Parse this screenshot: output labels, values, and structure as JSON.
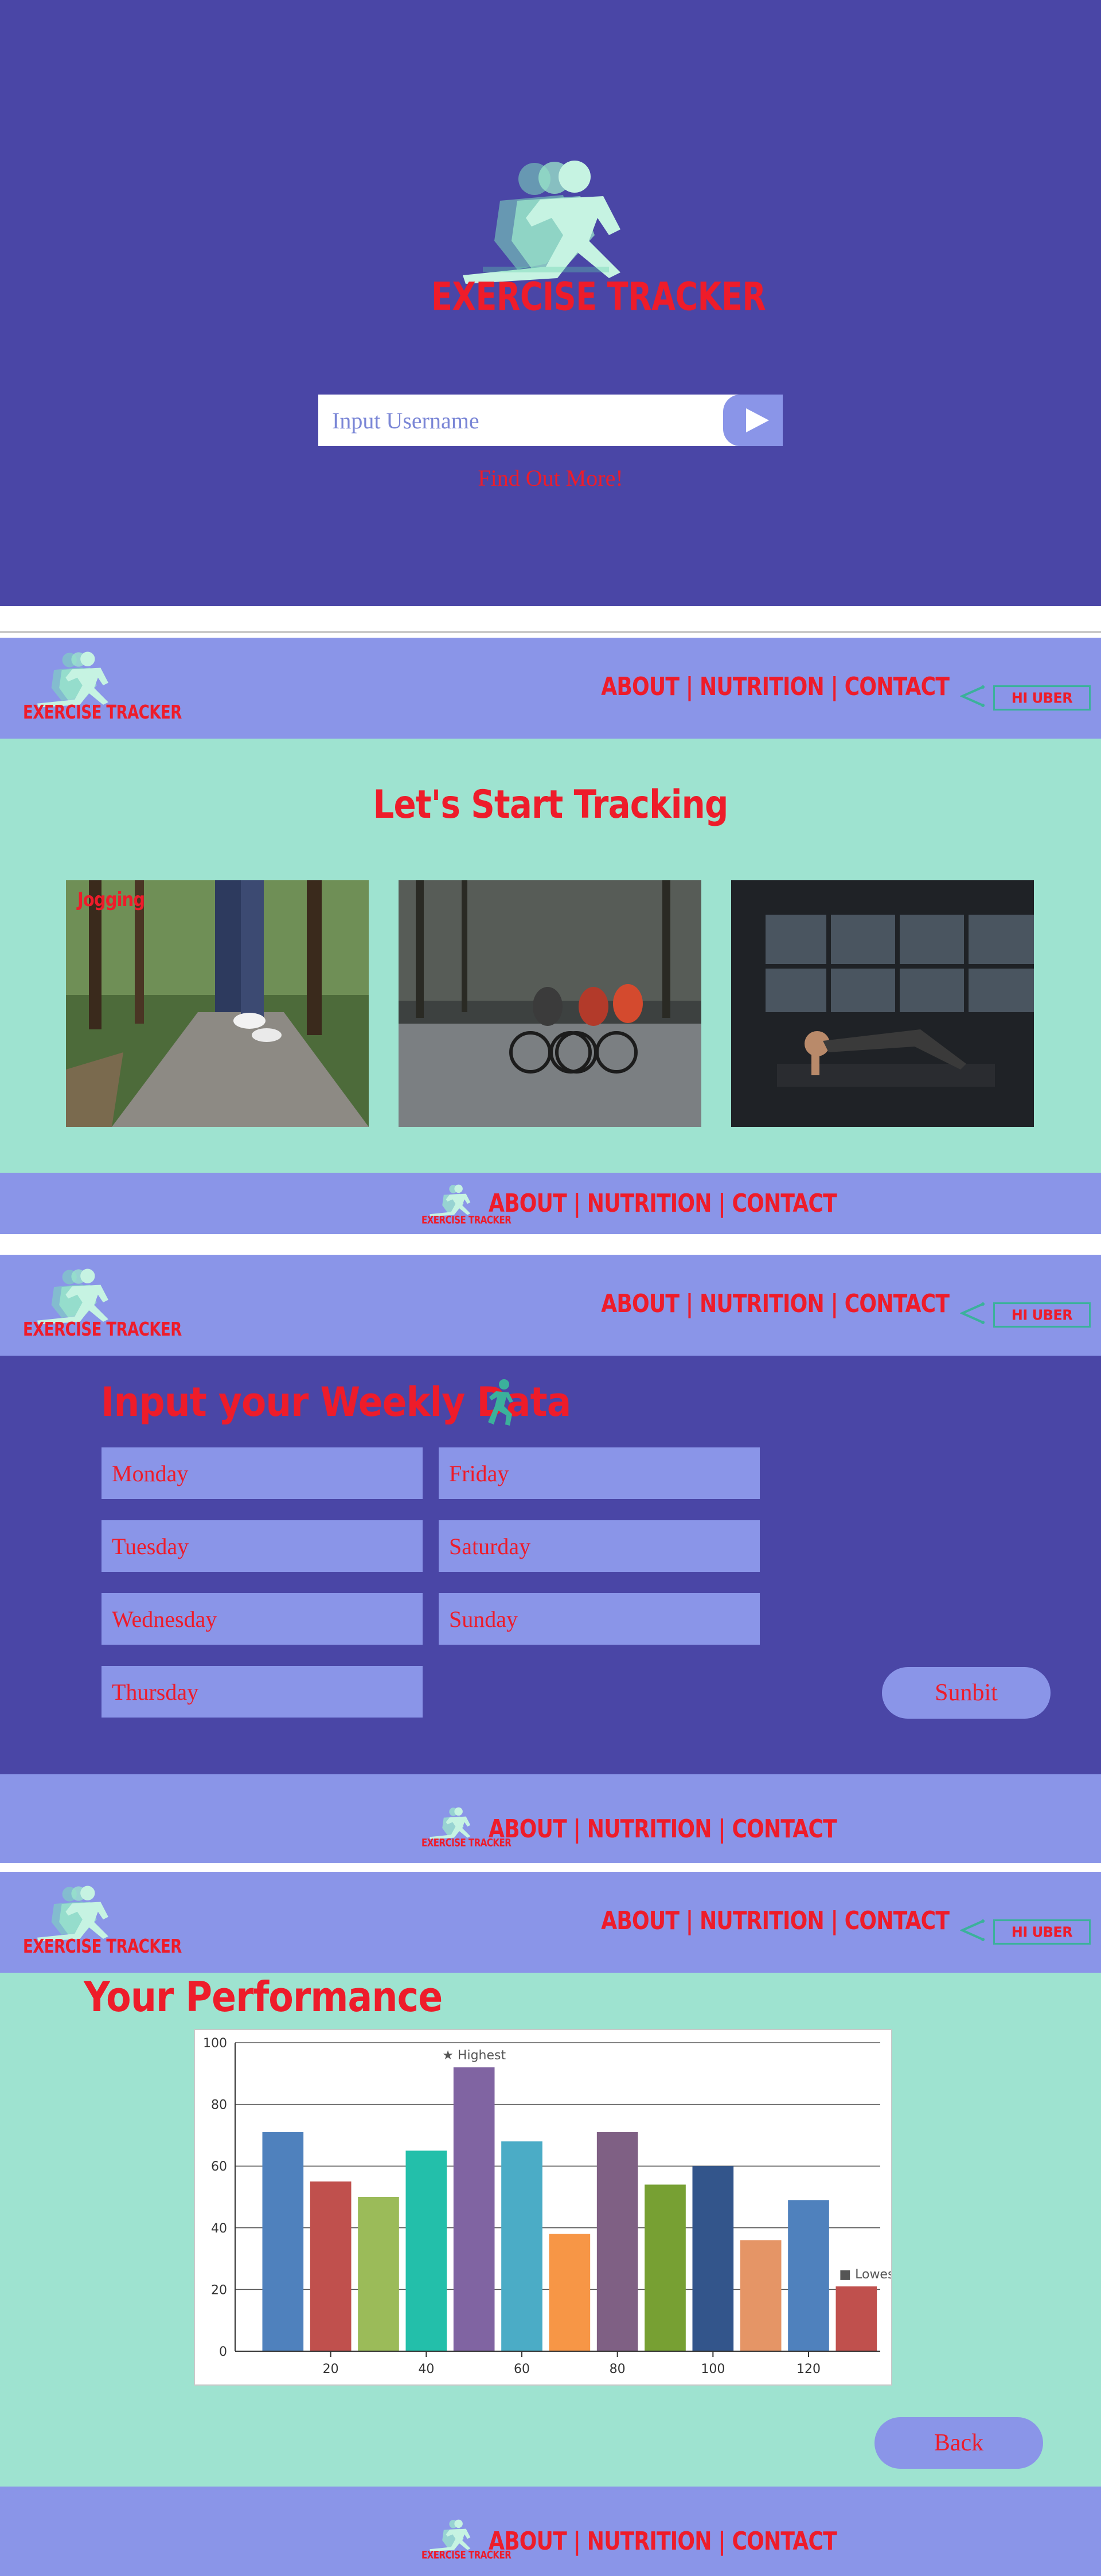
{
  "brand": {
    "logo_text": "EXERCISE TRACKER"
  },
  "login": {
    "username_placeholder": "Input Username",
    "find_link": "Find Out More!"
  },
  "nav": {
    "links": [
      "ABOUT",
      "NUTRITION",
      "CONTACT"
    ],
    "separator": "|",
    "user_label": "HI UBER"
  },
  "tracking": {
    "title": "Let's Start Tracking",
    "cards": [
      {
        "label": "Jogging",
        "icon": "jogging-photo"
      },
      {
        "label": "",
        "icon": "cycling-photo"
      },
      {
        "label": "",
        "icon": "pushup-photo"
      }
    ]
  },
  "weekly": {
    "title": "Input your Weekly Data",
    "days_left": [
      "Monday",
      "Tuesday",
      "Wednesday",
      "Thursday"
    ],
    "days_right": [
      "Friday",
      "Saturday",
      "Sunday"
    ],
    "submit_label": "Sunbit"
  },
  "performance": {
    "title": "Your Performance",
    "back_label": "Back"
  },
  "colors": {
    "hero_bg": "#4a46a6",
    "nav_bg": "#8a95e8",
    "mint_bg": "#9ee3d0",
    "accent_red": "#ee1c2a",
    "logo_green": "#9ce8cb"
  },
  "chart_data": {
    "type": "bar",
    "x": [
      10,
      20,
      30,
      40,
      50,
      60,
      70,
      80,
      90,
      100,
      110,
      120,
      130
    ],
    "values": [
      71,
      55,
      50,
      65,
      92,
      68,
      38,
      71,
      54,
      60,
      36,
      49,
      21
    ],
    "colors": [
      "#4f81bd",
      "#c0504d",
      "#9bbb59",
      "#23bfaa",
      "#8064a2",
      "#4bacc6",
      "#f79646",
      "#7f6084",
      "#77a033",
      "#33558b",
      "#e59566",
      "#4f81bd",
      "#c0504d"
    ],
    "x_ticks": [
      20,
      40,
      60,
      80,
      100,
      120
    ],
    "y_ticks": [
      0,
      20,
      40,
      60,
      80,
      100
    ],
    "xlim": [
      0,
      135
    ],
    "ylim": [
      0,
      100
    ],
    "grid": true,
    "annotations": [
      {
        "x": 50,
        "text": "★ Highest"
      },
      {
        "x": 130,
        "text": "■ Lowest"
      }
    ]
  }
}
